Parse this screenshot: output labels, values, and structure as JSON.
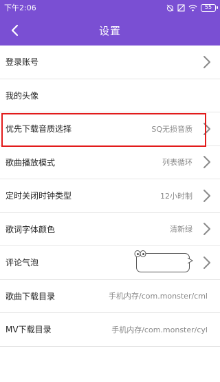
{
  "status_bar": {
    "time": "下午2:06",
    "battery": "55"
  },
  "header": {
    "title": "设置",
    "back_icon": "chevron-left-icon"
  },
  "settings": [
    {
      "label": "登录账号",
      "value": "",
      "chevron": true
    },
    {
      "label": "我的头像",
      "value": "",
      "chevron": false
    },
    {
      "label": "优先下载音质选择",
      "value": "SQ无损音质",
      "chevron": true,
      "highlighted": true
    },
    {
      "label": "歌曲播放模式",
      "value": "列表循环",
      "chevron": true
    },
    {
      "label": "定时关闭时钟类型",
      "value": "12小时制",
      "chevron": true
    },
    {
      "label": "歌词字体颜色",
      "value": "清新绿",
      "chevron": true
    },
    {
      "label": "评论气泡",
      "value": "",
      "chevron": true,
      "bubble_preview": true
    },
    {
      "label": "歌曲下载目录",
      "value": "手机内存/com.monster/cml",
      "chevron": false
    },
    {
      "label": "MV下载目录",
      "value": "手机内存/com.monster/cyl",
      "chevron": false
    }
  ],
  "colors": {
    "header_bg": "#7a4fd3",
    "highlight": "#e21b1b"
  }
}
